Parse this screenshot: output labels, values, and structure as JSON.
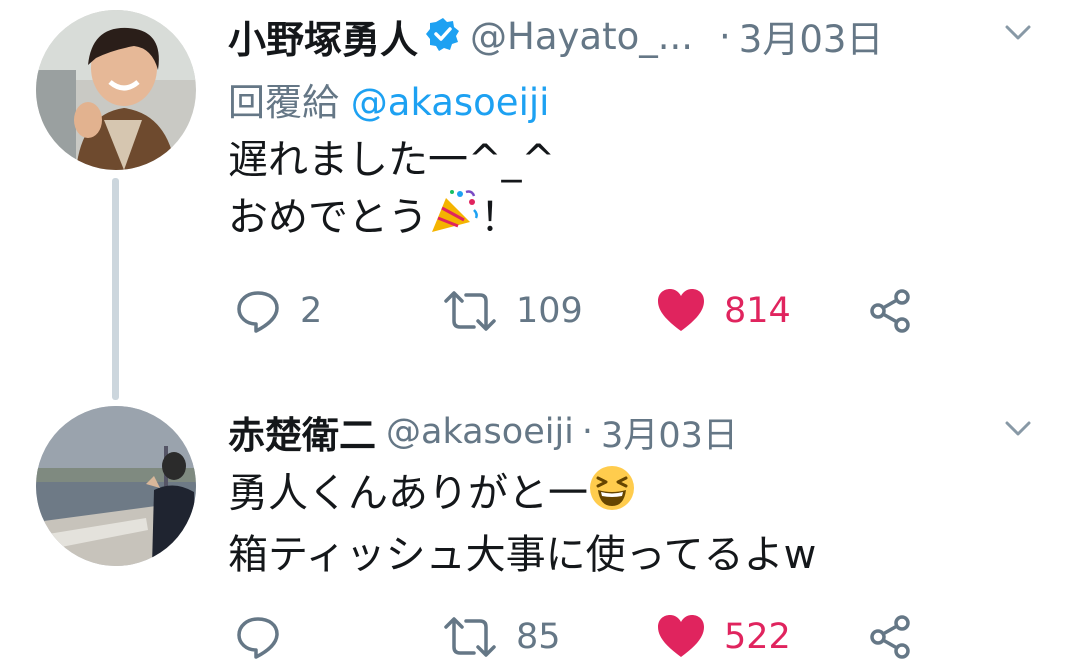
{
  "tweets": [
    {
      "display_name": "小野塚勇人",
      "handle": "@Hayato_...",
      "separator": "·",
      "date": "3月03日",
      "reply_prefix": "回覆給",
      "reply_to": "@akasoeiji",
      "text_line_1": "遅れました一^_^",
      "text_line_2": "おめでとう",
      "text_line_2_suffix": "！",
      "emoji": "party-popper-icon",
      "replies": "2",
      "retweets": "109",
      "likes": "814",
      "liked": true,
      "verified": true
    },
    {
      "display_name": "赤楚衛二",
      "handle": "@akasoeiji",
      "separator": "·",
      "date": "3月03日",
      "text_line_1": "勇人くんありがと一",
      "text_line_2": "箱ティッシュ大事に使ってるよw",
      "emoji": "grinning-squinting-face-icon",
      "replies": "",
      "retweets": "85",
      "likes": "522",
      "liked": true,
      "verified": false
    }
  ],
  "colors": {
    "like": "#e0245e",
    "link": "#1da1f2",
    "muted": "#657786",
    "thread_line": "#ccd6dd",
    "verified": "#1da1f2"
  }
}
